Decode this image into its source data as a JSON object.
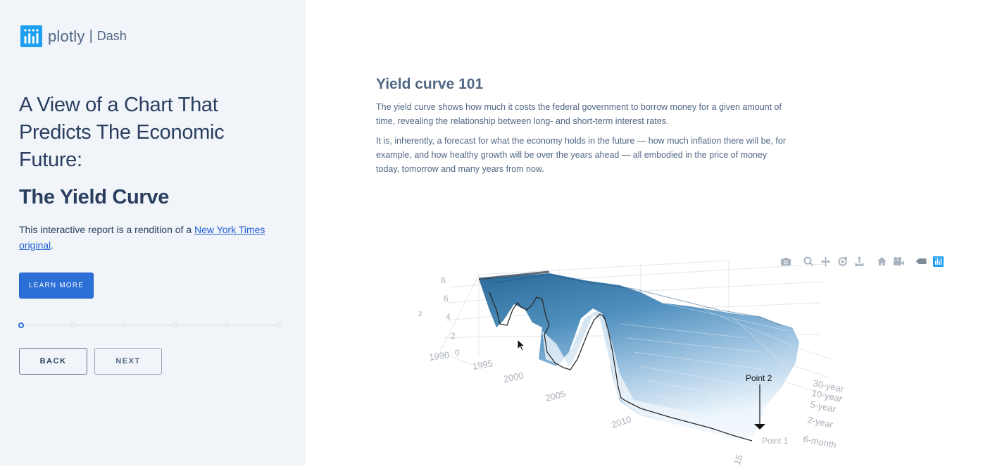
{
  "brand": {
    "name": "plotly",
    "product": "Dash",
    "separator": "|",
    "icon": "plotly-logo-icon"
  },
  "sidebar": {
    "title": "A View of a Chart That Predicts The Economic Future:",
    "subtitle": "The Yield Curve",
    "intro_text": "This interactive report is a rendition of a ",
    "link_text": "New York Times original",
    "intro_end": ".",
    "learn_more": "LEARN MORE",
    "slider": {
      "steps": 6,
      "current_step": 1
    },
    "back_label": "BACK",
    "next_label": "NEXT"
  },
  "main": {
    "heading": "Yield curve 101",
    "paragraph1": "The yield curve shows how much it costs the federal government to borrow money for a given amount of time, revealing the relationship between long- and short-term interest rates.",
    "paragraph2": "It is, inherently, a forecast for what the economy holds in the future — how much inflation there will be, for example, and how healthy growth will be over the years ahead — all embodied in the price of money today, tomorrow and many years from now."
  },
  "modebar": [
    "camera-icon",
    "zoom-icon",
    "pan-icon",
    "orbit-rotation-icon",
    "turntable-rotation-icon",
    "reset-camera-icon",
    "save-camera-icon",
    "hover-tag-icon",
    "plotly-logo-icon"
  ],
  "chart_data": {
    "type": "surface",
    "z_axis": {
      "title": "z",
      "ticks": [
        "0",
        "2",
        "4",
        "6",
        "8"
      ]
    },
    "x_axis": {
      "ticks": [
        "1990",
        "1995",
        "2000",
        "2005",
        "2010",
        "15"
      ]
    },
    "y_axis": {
      "ticks": [
        "6-month",
        "2-year",
        "5-year",
        "10-year",
        "30-year"
      ]
    },
    "annotations": [
      "Point 1",
      "Point 2"
    ],
    "colors": {
      "surface_dark": "#1f5f8f",
      "surface_light": "#e8f3fb",
      "line": "#2a2a2a"
    }
  }
}
